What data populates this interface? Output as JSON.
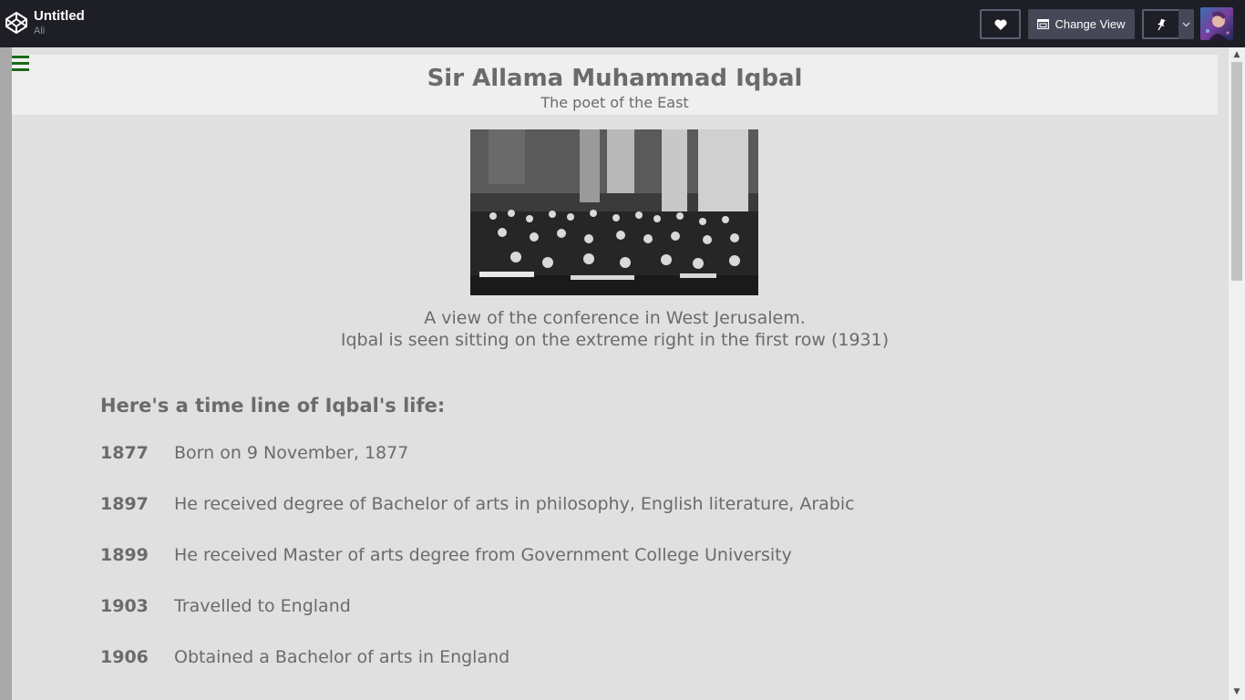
{
  "topbar": {
    "title": "Untitled",
    "user": "Ali",
    "change_view_label": "Change View"
  },
  "page": {
    "title": "Sir Allama Muhammad Iqbal",
    "subtitle": "The poet of the East",
    "caption_line1": "A view of the conference in West Jerusalem.",
    "caption_line2": "Iqbal is seen sitting on the extreme right in the first row (1931)",
    "timeline_heading": "Here's a time line of Iqbal's life:",
    "timeline": [
      {
        "year": "1877",
        "event": "Born on 9 November, 1877"
      },
      {
        "year": "1897",
        "event": "He received degree of Bachelor of arts in philosophy, English literature, Arabic"
      },
      {
        "year": "1899",
        "event": "He received Master of arts degree from Government College University"
      },
      {
        "year": "1903",
        "event": "Travelled to England"
      },
      {
        "year": "1906",
        "event": "Obtained a Bachelor of arts in England"
      }
    ]
  },
  "colors": {
    "topbar_bg": "#1e1f26",
    "button_bg": "#444857",
    "preview_bg": "#e0e0e0",
    "header_bg": "#efefef",
    "text": "#6b6b6b",
    "menu_icon": "#1a6b1a"
  },
  "icons": [
    "codepen-logo-icon",
    "heart-icon",
    "change-view-icon",
    "pin-icon",
    "chevron-down-icon",
    "menu-icon"
  ]
}
